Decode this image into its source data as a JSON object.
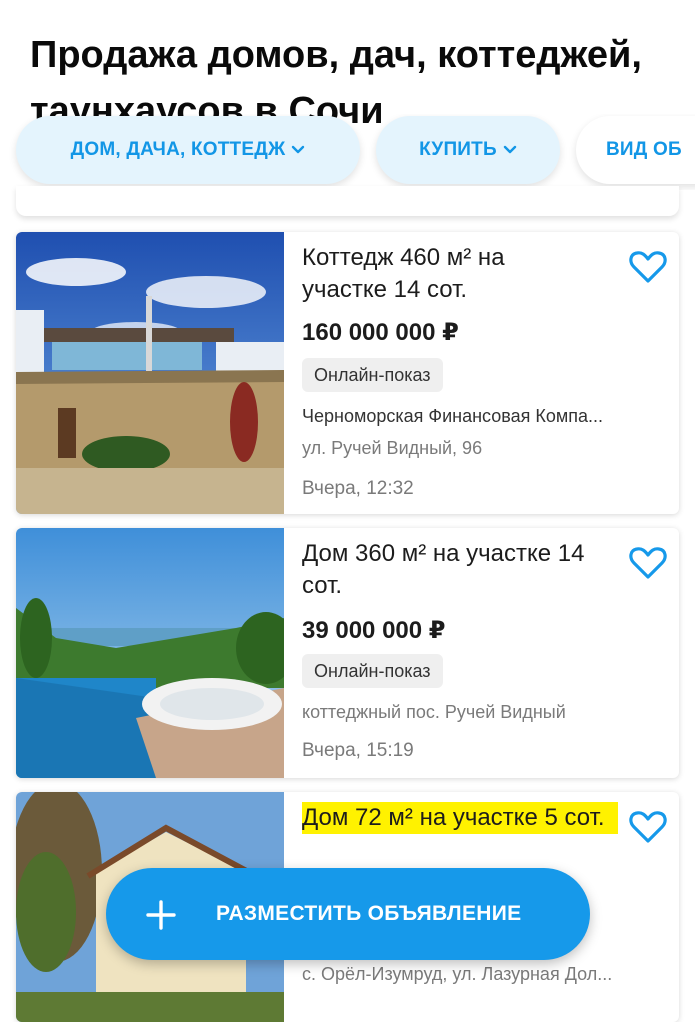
{
  "page": {
    "title": "Продажа домов, дач, коттеджей, таунхаусов в Сочи"
  },
  "filters": [
    {
      "label": "ДОМ, ДАЧА, КОТТЕДЖ"
    },
    {
      "label": "КУПИТЬ"
    },
    {
      "label": "ВИД ОБ"
    }
  ],
  "listings": [
    {
      "title": "Коттедж 460 м² на участке 14 сот.",
      "price": "160 000 000 ₽",
      "badge": "Онлайн-показ",
      "seller": "Черноморская Финансовая Компа...",
      "address": "ул. Ручей Видный, 96",
      "date": "Вчера, 12:32"
    },
    {
      "title": "Дом 360 м² на участке 14 сот.",
      "price": "39 000 000 ₽",
      "badge": "Онлайн-показ",
      "address": "коттеджный пос. Ручей Видный",
      "date": "Вчера, 15:19"
    },
    {
      "title": "Дом 72 м² на участке 5 сот.",
      "address": "с. Орёл-Изумруд, ул. Лазурная Дол..."
    }
  ],
  "cta": {
    "label": "РАЗМЕСТИТЬ ОБЪЯВЛЕНИЕ"
  },
  "colors": {
    "accent": "#1699ea",
    "chip_bg": "#e4f4fd",
    "highlight": "#fff200"
  }
}
